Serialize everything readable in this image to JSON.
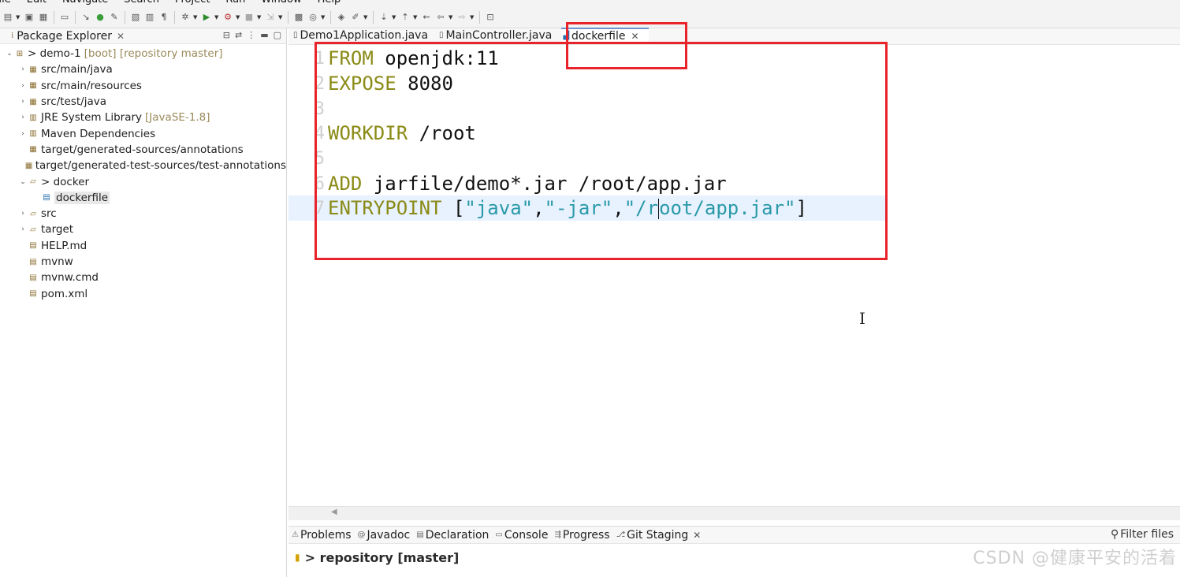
{
  "menubar": {
    "items": [
      "File",
      "Edit",
      "Navigate",
      "Search",
      "Project",
      "Run",
      "Window",
      "Help"
    ]
  },
  "package_explorer": {
    "title": "Package Explorer",
    "tree": [
      {
        "label": "> demo-1",
        "suffix": "[boot] [repository master]",
        "indent": 0,
        "twisty": "v",
        "icon": "project-icon"
      },
      {
        "label": "src/main/java",
        "indent": 1,
        "twisty": ">",
        "icon": "package-folder-icon"
      },
      {
        "label": "src/main/resources",
        "indent": 1,
        "twisty": ">",
        "icon": "package-folder-icon"
      },
      {
        "label": "src/test/java",
        "indent": 1,
        "twisty": ">",
        "icon": "package-folder-icon"
      },
      {
        "label": "JRE System Library",
        "suffix": "[JavaSE-1.8]",
        "indent": 1,
        "twisty": ">",
        "icon": "library-icon"
      },
      {
        "label": "Maven Dependencies",
        "indent": 1,
        "twisty": ">",
        "icon": "library-icon"
      },
      {
        "label": "target/generated-sources/annotations",
        "indent": 1,
        "twisty": "",
        "icon": "package-folder-icon"
      },
      {
        "label": "target/generated-test-sources/test-annotations",
        "indent": 1,
        "twisty": "",
        "icon": "package-folder-icon"
      },
      {
        "label": "> docker",
        "indent": 1,
        "twisty": "v",
        "icon": "folder-icon"
      },
      {
        "label": "dockerfile",
        "indent": 2,
        "twisty": "",
        "icon": "file-icon",
        "selected": true
      },
      {
        "label": "src",
        "indent": 1,
        "twisty": ">",
        "icon": "folder-icon"
      },
      {
        "label": "target",
        "indent": 1,
        "twisty": ">",
        "icon": "folder-icon"
      },
      {
        "label": "HELP.md",
        "indent": 1,
        "twisty": "",
        "icon": "file-icon"
      },
      {
        "label": "mvnw",
        "indent": 1,
        "twisty": "",
        "icon": "file-icon"
      },
      {
        "label": "mvnw.cmd",
        "indent": 1,
        "twisty": "",
        "icon": "file-icon"
      },
      {
        "label": "pom.xml",
        "indent": 1,
        "twisty": "",
        "icon": "xml-file-icon"
      }
    ]
  },
  "editor": {
    "tabs": [
      {
        "label": "Demo1Application.java",
        "active": false
      },
      {
        "label": "MainController.java",
        "active": false
      },
      {
        "label": "dockerfile",
        "active": true
      }
    ],
    "lines": [
      {
        "num": "1",
        "parts": [
          {
            "t": "FROM",
            "c": "kw"
          },
          {
            "t": " openjdk:11",
            "c": "tx"
          }
        ]
      },
      {
        "num": "2",
        "parts": [
          {
            "t": "EXPOSE",
            "c": "kw"
          },
          {
            "t": " 8080",
            "c": "tx"
          }
        ]
      },
      {
        "num": "3",
        "parts": []
      },
      {
        "num": "4",
        "parts": [
          {
            "t": "WORKDIR",
            "c": "kw"
          },
          {
            "t": " /root",
            "c": "tx"
          }
        ]
      },
      {
        "num": "5",
        "parts": []
      },
      {
        "num": "6",
        "parts": [
          {
            "t": "ADD",
            "c": "kw"
          },
          {
            "t": " jarfile/demo*.jar /root/app.jar",
            "c": "tx"
          }
        ]
      },
      {
        "num": "7",
        "current": true,
        "parts": [
          {
            "t": "ENTRYPOINT",
            "c": "kw"
          },
          {
            "t": " [",
            "c": "tx"
          },
          {
            "t": "\"java\"",
            "c": "st"
          },
          {
            "t": ",",
            "c": "tx"
          },
          {
            "t": "\"-jar\"",
            "c": "st"
          },
          {
            "t": ",",
            "c": "tx"
          },
          {
            "t": "\"/r",
            "c": "st"
          },
          {
            "t": "|caret|",
            "c": "caret"
          },
          {
            "t": "oot/app.jar\"",
            "c": "st"
          },
          {
            "t": "]",
            "c": "tx"
          }
        ]
      }
    ]
  },
  "bottom_panel": {
    "tabs": [
      {
        "label": "Problems",
        "icon": "problems-icon"
      },
      {
        "label": "Javadoc",
        "icon": "javadoc-icon"
      },
      {
        "label": "Declaration",
        "icon": "declaration-icon"
      },
      {
        "label": "Console",
        "icon": "console-icon"
      },
      {
        "label": "Progress",
        "icon": "progress-icon"
      },
      {
        "label": "Git Staging",
        "icon": "git-staging-icon",
        "closable": true
      }
    ],
    "filter_label": "Filter files",
    "repository": "> repository [master]"
  },
  "watermark": "CSDN @健康平安的活着",
  "colors": {
    "highlight_box": "#e8232a",
    "keyword": "#8a8a16",
    "string": "#2a9aa8",
    "current_line": "#e8f2fe"
  }
}
